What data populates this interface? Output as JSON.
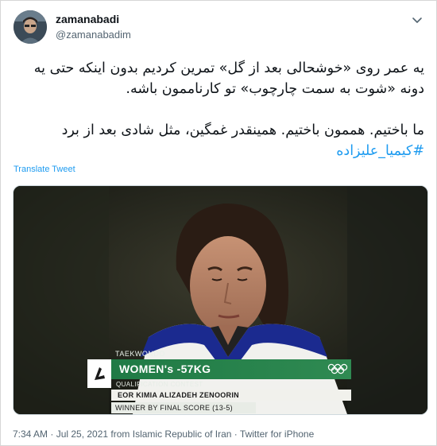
{
  "user": {
    "display_name": "zamanabadi",
    "handle": "@zamanabadim"
  },
  "tweet": {
    "paragraph1": "یه عمر روی «خوشحالی بعد از گل» تمرین کردیم بدون اینکه حتی یه دونه «شوت به سمت چارچوب» تو کارناممون باشه.",
    "paragraph2_text": "ما باختیم. هممون باختیم. همینقدر غمگین، مثل شادی بعد از برد ",
    "hashtag": "#کیمیا_علیزاده",
    "translate_label": "Translate Tweet"
  },
  "media": {
    "sport": "TAEKWONDO",
    "event": "WOMEN's -57KG",
    "stage": "QUALIFICATION CONTEST",
    "athlete": "KIMIA ALIZADEH ZENOORIN",
    "country_code": "EOR",
    "result": "WINNER BY FINAL SCORE (13-5)"
  },
  "footer": {
    "timestamp": "7:34 AM · Jul 25, 2021 from Islamic Republic of Iran · Twitter for iPhone"
  },
  "icons": {
    "menu": "chevron-down-icon",
    "olympic": "olympic-rings-icon"
  },
  "colors": {
    "link": "#1d9bf0",
    "event_bar": "#1f7a45"
  }
}
